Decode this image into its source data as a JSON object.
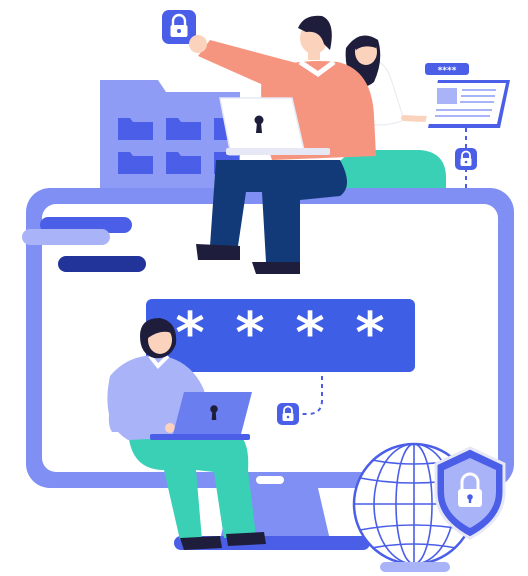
{
  "illustration": {
    "theme": "password-security",
    "password_field": {
      "masked_value": "****",
      "mask_char": "*",
      "char_count": 4
    },
    "card": {
      "masked_rating": "****"
    },
    "icons": [
      "padlock-badge-icon",
      "folder-icon",
      "laptop-icon",
      "keyhole-icon",
      "document-card-icon",
      "globe-icon",
      "shield-lock-icon"
    ],
    "colors": {
      "accent": "#4a5ee8",
      "monitor_frame": "#7f8ff4",
      "light_blue": "#a9b3f8",
      "navy": "#223399",
      "field_blue": "#3f5ee6",
      "skin": "#fbd3bd",
      "shirt_salmon": "#f6957f",
      "teal": "#39d0b6",
      "pants_navy": "#123a78",
      "hair": "#1e1e3c"
    }
  }
}
